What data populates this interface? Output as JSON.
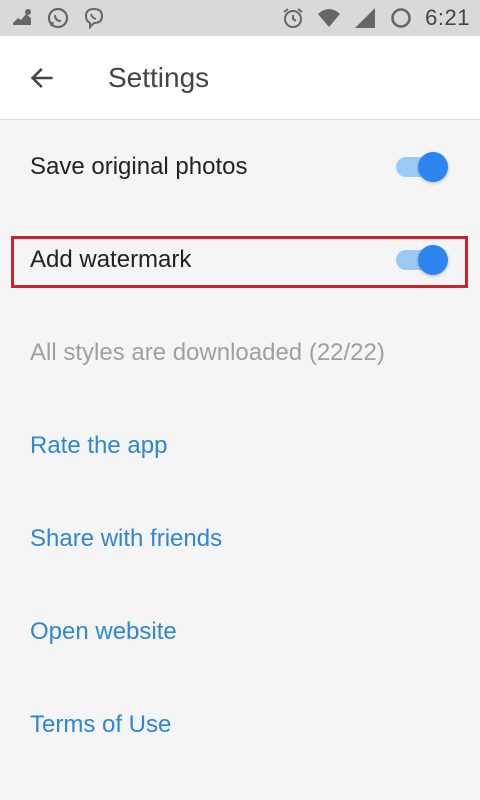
{
  "status_bar": {
    "time": "6:21",
    "icons_left": [
      "notification-app-icon",
      "whatsapp-icon",
      "viber-icon"
    ],
    "icons_right": [
      "alarm-icon",
      "wifi-icon",
      "signal-icon",
      "battery-icon"
    ]
  },
  "app_bar": {
    "title": "Settings",
    "back_icon": "arrow-back-icon"
  },
  "settings": {
    "save_original": {
      "label": "Save original photos",
      "enabled": true
    },
    "add_watermark": {
      "label": "Add watermark",
      "enabled": true
    },
    "styles_status": "All styles are downloaded (22/22)",
    "rate_app": "Rate the app",
    "share": "Share with friends",
    "website": "Open website",
    "terms": "Terms of Use"
  },
  "colors": {
    "accent": "#2d86ef",
    "link": "#2d86d8",
    "highlight": "#d0202b",
    "toggle_track": "#9ccaf7"
  }
}
